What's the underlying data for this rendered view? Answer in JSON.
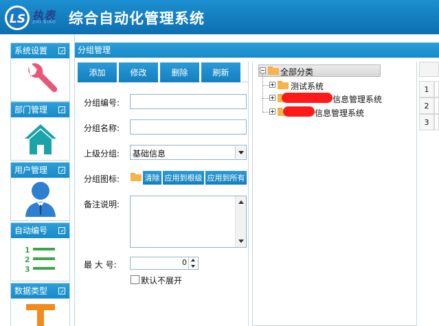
{
  "header": {
    "brand": "执表",
    "brand_sub": "ZHI BIAO",
    "title": "综合自动化管理系统"
  },
  "sidebar": {
    "panels": [
      {
        "label": "系统设置",
        "icon": "wrench-icon"
      },
      {
        "label": "部门管理",
        "icon": "house-icon"
      },
      {
        "label": "用户管理",
        "icon": "user-icon"
      },
      {
        "label": "自动编号",
        "icon": "numbered-list-icon"
      },
      {
        "label": "数据类型",
        "icon": "t-shape-icon"
      }
    ]
  },
  "main": {
    "panel_title": "分组管理",
    "toolbar": {
      "add": "添加",
      "edit": "修改",
      "delete": "删除",
      "refresh": "刷新"
    },
    "form": {
      "group_no_label": "分组编号:",
      "group_no_value": "",
      "group_name_label": "分组名称:",
      "group_name_value": "",
      "parent_label": "上级分组:",
      "parent_value": "基础信息",
      "icon_label": "分组图标:",
      "clear_btn": "清除",
      "apply_root_btn": "应用到根级",
      "apply_all_btn": "应用到所有",
      "note_label": "备注说明:",
      "note_value": "",
      "max_label": "最 大 号:",
      "max_value": "0",
      "no_expand_label": "默认不展开"
    },
    "tree": {
      "root": "全部分类",
      "children": [
        {
          "label": "测试系统"
        },
        {
          "label": "信息管理系统"
        },
        {
          "label": "信息管理系统"
        }
      ]
    },
    "grid": {
      "row_numbers": [
        "1",
        "2",
        "3"
      ]
    }
  },
  "colors": {
    "accent": "#168bc9",
    "header": "#0c6fb0",
    "icon_pink": "#e8567a",
    "icon_teal": "#1aa3a8",
    "icon_blue": "#2f7fd0",
    "icon_green": "#3aa64a",
    "icon_orange": "#f28b1e",
    "folder": "#f7b44a",
    "redaction": "#ff1a1a"
  }
}
